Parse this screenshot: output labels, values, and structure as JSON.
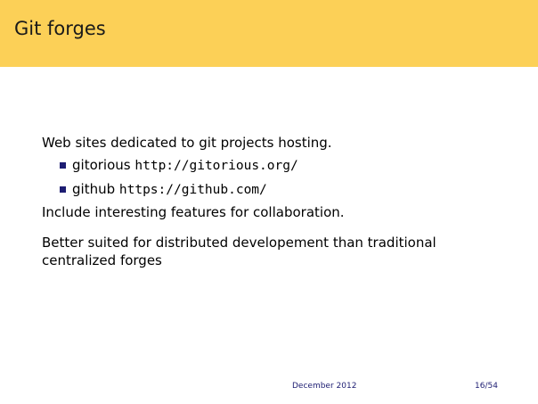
{
  "slide": {
    "title": "Git forges"
  },
  "content": {
    "intro": "Web sites dedicated to git projects hosting.",
    "bullets": [
      {
        "name": "gitorious",
        "url": "http://gitorious.org/"
      },
      {
        "name": "github",
        "url": "https://github.com/"
      }
    ],
    "features": "Include interesting features for collaboration.",
    "conclusion": "Better suited for distributed developement than traditional centralized forges"
  },
  "footer": {
    "date": "December 2012",
    "page": "16/54"
  },
  "colors": {
    "title_bar": "#fcd057",
    "bullet": "#1d1d72",
    "footer_text": "#1d1d72"
  }
}
